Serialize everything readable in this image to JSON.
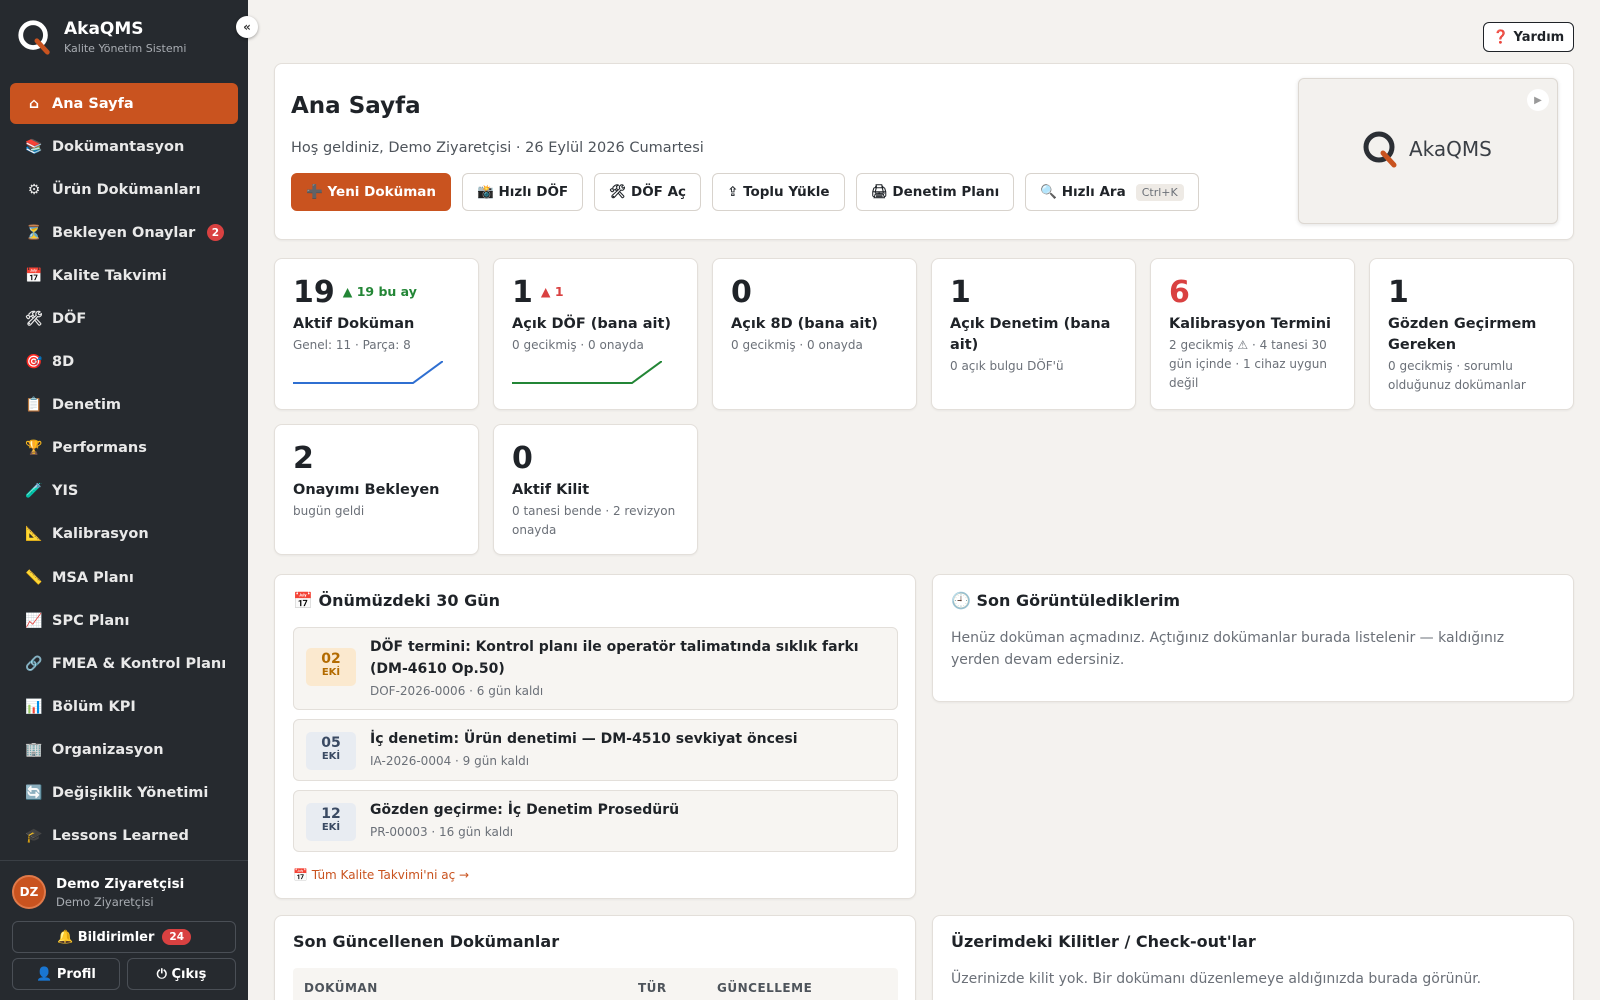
{
  "brand": {
    "name": "AkaQMS",
    "subtitle": "Kalite Yönetim Sistemi",
    "collapse": "«",
    "accent": "#c9531f"
  },
  "sidebar": {
    "items": [
      {
        "label": "Ana Sayfa",
        "icon": "⌂",
        "active": true
      },
      {
        "label": "Dokümantasyon",
        "icon": "📚"
      },
      {
        "label": "Ürün Dokümanları",
        "icon": "⚙"
      },
      {
        "label": "Bekleyen Onaylar",
        "icon": "⏳",
        "badge": "2"
      },
      {
        "label": "Kalite Takvimi",
        "icon": "📅"
      },
      {
        "label": "DÖF",
        "icon": "🛠"
      },
      {
        "label": "8D",
        "icon": "🎯"
      },
      {
        "label": "Denetim",
        "icon": "📋"
      },
      {
        "label": "Performans",
        "icon": "🏆"
      },
      {
        "label": "YIS",
        "icon": "🧪"
      },
      {
        "label": "Kalibrasyon",
        "icon": "📐"
      },
      {
        "label": "MSA Planı",
        "icon": "📏"
      },
      {
        "label": "SPC Planı",
        "icon": "📈"
      },
      {
        "label": "FMEA & Kontrol Planı",
        "icon": "🔗"
      },
      {
        "label": "Bölüm KPI",
        "icon": "📊"
      },
      {
        "label": "Organizasyon",
        "icon": "🏢"
      },
      {
        "label": "Değişiklik Yönetimi",
        "icon": "🔄"
      },
      {
        "label": "Lessons Learned",
        "icon": "🎓"
      }
    ]
  },
  "user": {
    "initials": "DZ",
    "name": "Demo Ziyaretçisi",
    "role": "Demo Ziyaretçisi"
  },
  "bottom": {
    "notifications_label": "🔔 Bildirimler",
    "notifications_count": "24",
    "profile_label": "👤 Profil",
    "logout_label": "⏻ Çıkış"
  },
  "header": {
    "help_label": "❓ Yardım"
  },
  "hero": {
    "title": "Ana Sayfa",
    "welcome": "Hoş geldiniz, Demo Ziyaretçisi · 26 Eylül 2026 Cumartesi",
    "actions": [
      {
        "label": "➕ Yeni Doküman",
        "primary": true
      },
      {
        "label": "📸 Hızlı DÖF"
      },
      {
        "label": "🛠 DÖF Aç"
      },
      {
        "label": "⇪ Toplu Yükle"
      },
      {
        "label": "🖨 Denetim Planı"
      },
      {
        "label": "🔍 Hızlı Ara",
        "kbd": "Ctrl+K"
      }
    ],
    "video_logo": "AkaQMS"
  },
  "stats": [
    {
      "value": "19",
      "delta": "▲ 19 bu ay",
      "delta_color": "green",
      "label": "Aktif Doküman",
      "sub": "Genel: 11 · Parça: 8",
      "spark": [
        0,
        0,
        0,
        0,
        0,
        19
      ],
      "spark_color": "#2f6fd1"
    },
    {
      "value": "1",
      "delta": "▲ 1",
      "delta_color": "red",
      "label": "Açık DÖF (bana ait)",
      "sub": "0 gecikmiş · 0 onayda",
      "spark": [
        0,
        0,
        0,
        0,
        0,
        1
      ],
      "spark_color": "#238636"
    },
    {
      "value": "0",
      "label": "Açık 8D (bana ait)",
      "sub": "0 gecikmiş · 0 onayda"
    },
    {
      "value": "1",
      "label": "Açık Denetim (bana ait)",
      "sub": "0 açık bulgu DÖF'ü"
    },
    {
      "value": "6",
      "value_color": "red",
      "label": "Kalibrasyon Termini",
      "sub": "2 gecikmiş ⚠ · 4 tanesi 30 gün içinde · 1 cihaz uygun değil"
    },
    {
      "value": "1",
      "label": "Gözden Geçirmem Gereken",
      "sub": "0 gecikmiş · sorumlu olduğunuz dokümanlar"
    },
    {
      "value": "2",
      "label": "Onayımı Bekleyen",
      "sub": "bugün geldi"
    },
    {
      "value": "0",
      "label": "Aktif Kilit",
      "sub": "0 tanesi bende · 2 revizyon onayda"
    }
  ],
  "upcoming": {
    "title": "📅 Önümüzdeki 30 Gün",
    "items": [
      {
        "day": "02",
        "month": "EKİ",
        "title": "DÖF termini: Kontrol planı ile operatör talimatında sıklık farkı (DM-4610 Op.50)",
        "sub": "DOF-2026-0006 · 6 gün kaldı",
        "tone": "warn"
      },
      {
        "day": "05",
        "month": "EKİ",
        "title": "İç denetim: Ürün denetimi — DM-4510 sevkiyat öncesi",
        "sub": "IA-2026-0004 · 9 gün kaldı",
        "tone": "info"
      },
      {
        "day": "12",
        "month": "EKİ",
        "title": "Gözden geçirme: İç Denetim Prosedürü",
        "sub": "PR-00003 · 16 gün kaldı",
        "tone": "info"
      }
    ],
    "link": "📅 Tüm Kalite Takvimi'ni aç →"
  },
  "recent": {
    "title": "🕘 Son Görüntülediklerim",
    "text": "Henüz doküman açmadınız. Açtığınız dokümanlar burada listelenir — kaldığınız yerden devam edersiniz."
  },
  "updated": {
    "title": "Son Güncellenen Dokümanlar",
    "columns": [
      "DOKÜMAN",
      "TÜR",
      "GÜNCELLEME"
    ]
  },
  "locks": {
    "title": "Üzerimdeki Kilitler / Check-out'lar",
    "text": "Üzerinizde kilit yok. Bir dokümanı düzenlemeye aldığınızda burada görünür."
  }
}
